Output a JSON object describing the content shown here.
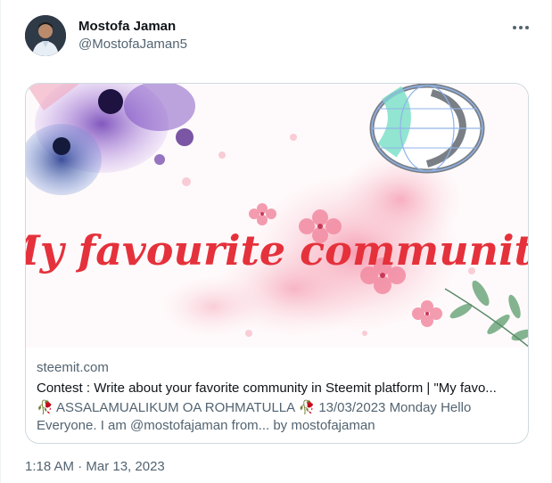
{
  "author": {
    "display_name": "Mostofa Jaman",
    "handle": "@MostofaJaman5",
    "avatar_icon": "profile-photo"
  },
  "menu": {
    "icon": "more-options-icon"
  },
  "card": {
    "image_text": "“My favourite community”",
    "domain": "steemit.com",
    "title": "Contest : Write about your favorite community in Steemit platform | \"My favo...",
    "description": "🥀 ASSALAMUALIKUM OA ROHMATULLA 🥀 13/03/2023 Monday Hello Everyone. I am @mostofajaman from... by mostofajaman",
    "accent_red": "#e5313b"
  },
  "timestamp": "1:18 AM · Mar 13, 2023"
}
